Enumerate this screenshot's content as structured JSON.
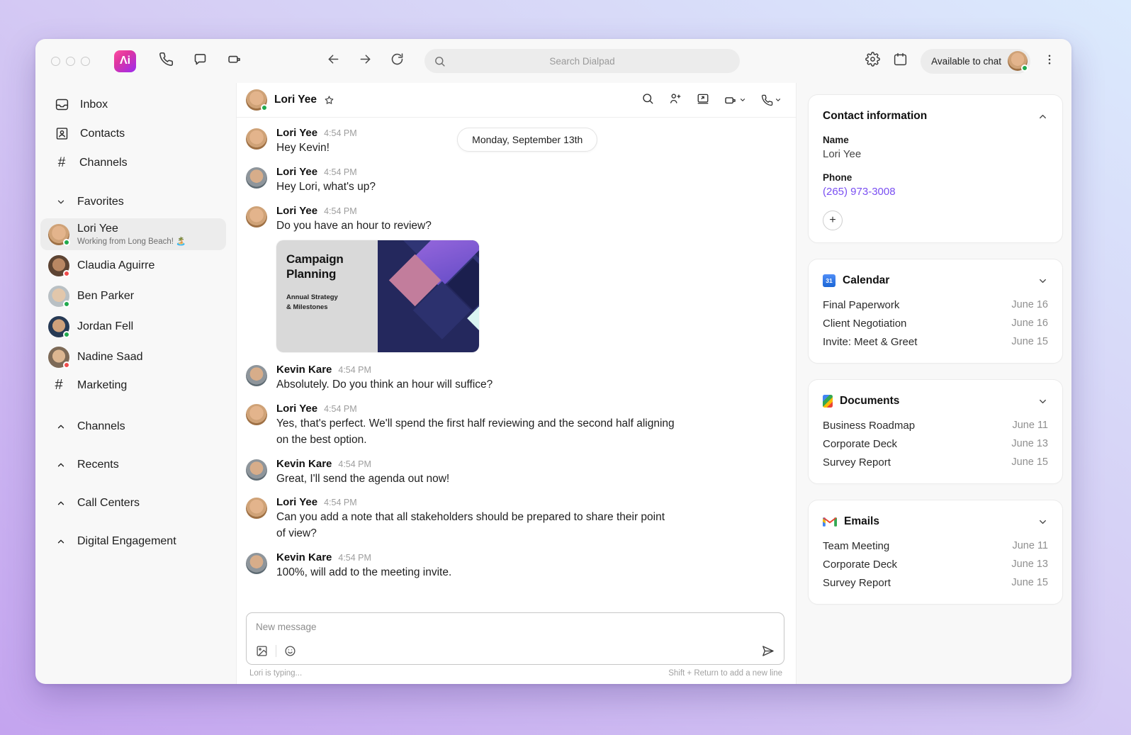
{
  "topbar": {
    "search_placeholder": "Search Dialpad",
    "availability": "Available to chat"
  },
  "icons": {
    "logo_glyph": "Λi",
    "hash_glyph": "#",
    "plus_glyph": "+",
    "calendar_badge": "31"
  },
  "colors": {
    "accent_purple": "#7a4ff2",
    "online_green": "#20a94d",
    "busy_red": "#ef4b4b"
  },
  "sidebar": {
    "nav": [
      {
        "label": "Inbox"
      },
      {
        "label": "Contacts"
      },
      {
        "label": "Channels"
      }
    ],
    "favorites_label": "Favorites",
    "favorites": [
      {
        "name": "Lori Yee",
        "subtitle": "Working from Long Beach! 🏝️"
      },
      {
        "name": "Claudia Aguirre"
      },
      {
        "name": "Ben Parker"
      },
      {
        "name": "Jordan Fell"
      },
      {
        "name": "Nadine Saad"
      },
      {
        "name": "Marketing"
      }
    ],
    "sections": [
      {
        "label": "Channels"
      },
      {
        "label": "Recents"
      },
      {
        "label": "Call Centers"
      },
      {
        "label": "Digital Engagement"
      }
    ]
  },
  "chat": {
    "contact_name": "Lori Yee",
    "date_pill": "Monday, September 13th",
    "messages": [
      {
        "author": "Lori Yee",
        "time": "4:54 PM",
        "text": "Hey Kevin!"
      },
      {
        "author": "Lori Yee",
        "time": "4:54 PM",
        "text": "Hey Lori, what's up?"
      },
      {
        "author": "Lori Yee",
        "time": "4:54 PM",
        "text": "Do you have an hour to review?"
      },
      {
        "author": "Kevin Kare",
        "time": "4:54 PM",
        "text": "Absolutely. Do you think an hour will suffice?"
      },
      {
        "author": "Lori Yee",
        "time": "4:54 PM",
        "text": "Yes, that's perfect. We'll spend the first half reviewing and the second half aligning on the best option."
      },
      {
        "author": "Kevin Kare",
        "time": "4:54 PM",
        "text": "Great, I'll send the agenda out now!"
      },
      {
        "author": "Lori Yee",
        "time": "4:54 PM",
        "text": "Can you add a note that all stakeholders should be prepared to share their point of view?"
      },
      {
        "author": "Kevin Kare",
        "time": "4:54 PM",
        "text": "100%, will add to the meeting invite."
      }
    ],
    "attachment": {
      "title": "Campaign Planning",
      "subtitle_line1": "Annual Strategy",
      "subtitle_line2": "& Milestones"
    },
    "composer": {
      "placeholder": "New message",
      "typing_status": "Lori is typing...",
      "newline_hint": "Shift + Return to add a new line"
    }
  },
  "panel": {
    "contact": {
      "title": "Contact information",
      "name_label": "Name",
      "name_value": "Lori Yee",
      "phone_label": "Phone",
      "phone_value": "(265) 973-3008"
    },
    "calendar": {
      "title": "Calendar",
      "items": [
        {
          "label": "Final Paperwork",
          "date": "June 16"
        },
        {
          "label": "Client Negotiation",
          "date": "June 16"
        },
        {
          "label": "Invite: Meet & Greet",
          "date": "June 15"
        }
      ]
    },
    "documents": {
      "title": "Documents",
      "items": [
        {
          "label": "Business Roadmap",
          "date": "June 11"
        },
        {
          "label": "Corporate Deck",
          "date": "June 13"
        },
        {
          "label": "Survey Report",
          "date": "June 15"
        }
      ]
    },
    "emails": {
      "title": "Emails",
      "items": [
        {
          "label": "Team Meeting",
          "date": "June 11"
        },
        {
          "label": "Corporate Deck",
          "date": "June 13"
        },
        {
          "label": "Survey Report",
          "date": "June 15"
        }
      ]
    }
  }
}
